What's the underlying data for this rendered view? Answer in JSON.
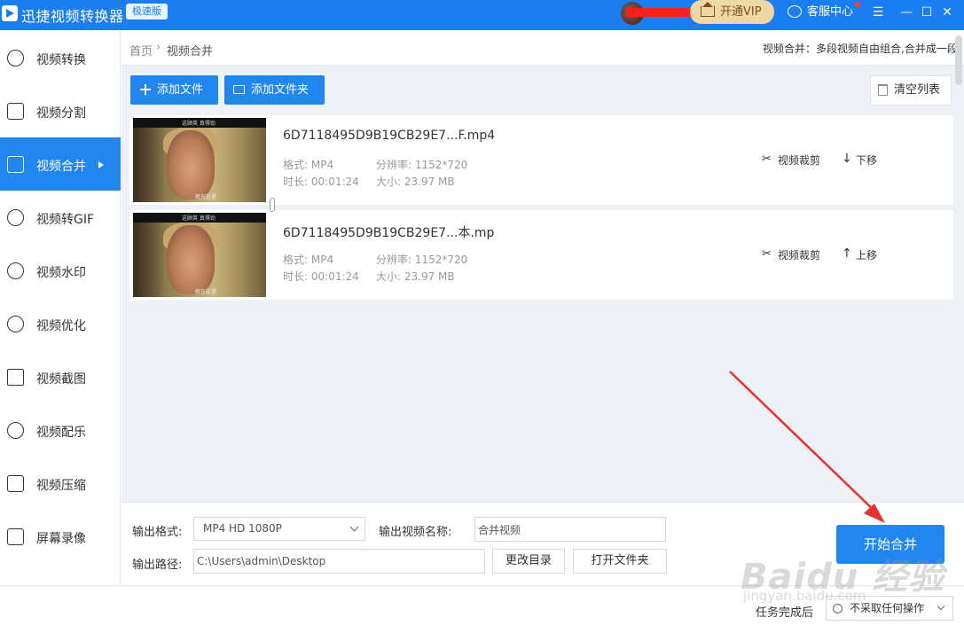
{
  "app": {
    "title": "迅捷视频转换器",
    "edition": "极速版"
  },
  "header": {
    "vip_label": "开通VIP",
    "service_label": "客服中心",
    "menu_glyph": "☰",
    "min_glyph": "—",
    "max_glyph": "☐",
    "close_glyph": "✕"
  },
  "sidebar": {
    "items": [
      {
        "label": "视频转换"
      },
      {
        "label": "视频分割"
      },
      {
        "label": "视频合并"
      },
      {
        "label": "视频转GIF"
      },
      {
        "label": "视频水印"
      },
      {
        "label": "视频优化"
      },
      {
        "label": "视频截图"
      },
      {
        "label": "视频配乐"
      },
      {
        "label": "视频压缩"
      },
      {
        "label": "屏幕录像"
      }
    ],
    "active_index": 2
  },
  "breadcrumb": {
    "home": "首页",
    "separator": "›",
    "current": "视频合并",
    "hint": "视频合并：多段视频自由组合,合并成一段"
  },
  "toolbar": {
    "add_file": "添加文件",
    "add_folder": "添加文件夹",
    "clear_list": "清空列表"
  },
  "thumb_caption_top": "这顾英 真得劲",
  "thumb_caption_bottom": "就在这里",
  "files": [
    {
      "name": "6D7118495D9B19CB29E7...F.mp4",
      "format_label": "格式:",
      "format": "MP4",
      "res_label": "分辨率:",
      "resolution": "1152*720",
      "duration_label": "时长:",
      "duration": "00:01:24",
      "size_label": "大小:",
      "size": "23.97 MB",
      "crop_label": "视频裁剪",
      "move_label": "下移",
      "move_glyph": "↓"
    },
    {
      "name": "6D7118495D9B19CB29E7...本.mp",
      "format_label": "格式:",
      "format": "MP4",
      "res_label": "分辨率:",
      "resolution": "1152*720",
      "duration_label": "时长:",
      "duration": "00:01:24",
      "size_label": "大小:",
      "size": "23.97 MB",
      "crop_label": "视频裁剪",
      "move_label": "上移",
      "move_glyph": "↑"
    }
  ],
  "settings": {
    "format_label": "输出格式:",
    "format_value": "MP4   HD 1080P",
    "name_label": "输出视频名称:",
    "name_value": "合并视频",
    "path_label": "输出路径:",
    "path_value": "C:\\Users\\admin\\Desktop",
    "change_dir": "更改目录",
    "open_folder": "打开文件夹",
    "start": "开始合并"
  },
  "status": {
    "after_label": "任务完成后",
    "after_value": "不采取任何操作"
  },
  "watermark": {
    "main": "Baidu 经验",
    "sub": "jingyan.baidu.com"
  },
  "colors": {
    "primary": "#2286f0",
    "titlebar": "#1a7ef0",
    "vip_gold": "#f0d7a6",
    "arrow_red": "#e8312e"
  }
}
